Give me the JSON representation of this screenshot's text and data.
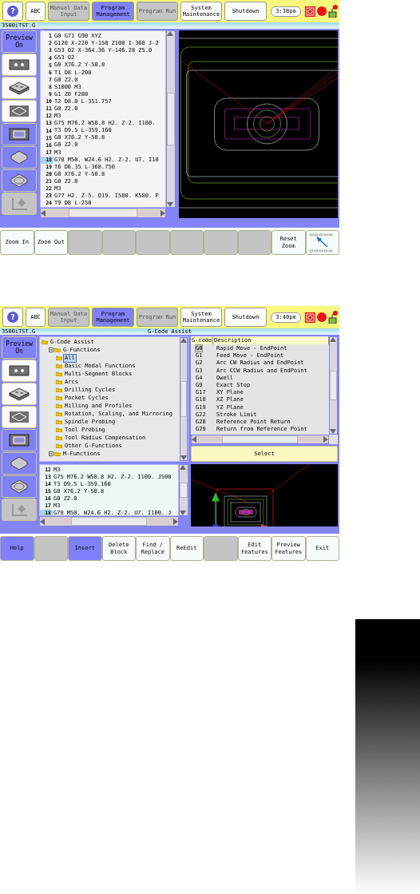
{
  "screens": [
    {
      "kind": "editor",
      "top_bar": {
        "buttons": [
          {
            "kind": "icon",
            "label": "?",
            "selected": false,
            "disabled": false
          },
          {
            "kind": "text",
            "label": "ABC",
            "selected": false,
            "disabled": false
          },
          {
            "kind": "text",
            "label": "Manual Data Input",
            "selected": false,
            "disabled": true
          },
          {
            "kind": "text",
            "label": "Program Management",
            "selected": true,
            "disabled": false
          },
          {
            "kind": "text",
            "label": "Program Run",
            "selected": false,
            "disabled": true
          },
          {
            "kind": "text",
            "label": "System Maintenance",
            "selected": false,
            "disabled": false
          },
          {
            "kind": "text",
            "label": "Shutdown",
            "selected": false,
            "disabled": false
          }
        ],
        "clock": "3:38pm"
      },
      "title_bar": {
        "file": "3500iTST.G"
      },
      "sidebar": [
        {
          "kind": "preview",
          "label": "Preview On",
          "selected": true,
          "disabled": false
        },
        {
          "kind": "plate",
          "selected": false,
          "disabled": false
        },
        {
          "kind": "block",
          "selected": false,
          "disabled": false
        },
        {
          "kind": "outline",
          "selected": false,
          "disabled": false
        },
        {
          "kind": "layout",
          "selected": true,
          "disabled": false
        },
        {
          "kind": "diamond",
          "selected": true,
          "disabled": false
        },
        {
          "kind": "diamond-outline",
          "selected": true,
          "disabled": false
        },
        {
          "kind": "pencil",
          "selected": false,
          "disabled": true
        }
      ],
      "code": {
        "lines": [
          {
            "n": "1",
            "text": "G0 G71 G90 XYZ",
            "selected": false
          },
          {
            "n": "2",
            "text": "G120 X-220 Y-150 Z100 I-360 J-2",
            "selected": false
          },
          {
            "n": "3",
            "text": "G53 O2 X-364.36 Y-146.28 Z5.0",
            "selected": false
          },
          {
            "n": "4",
            "text": "G53 O2",
            "selected": false
          },
          {
            "n": "5",
            "text": "G0 X76.2 Y-50.8",
            "selected": false
          },
          {
            "n": "6",
            "text": "T1 D8 L-200",
            "selected": false
          },
          {
            "n": "7",
            "text": "G0 Z2.0",
            "selected": false
          },
          {
            "n": "8",
            "text": "S1000 M3",
            "selected": false
          },
          {
            "n": "9",
            "text": "G1 Z0 F200",
            "selected": false
          },
          {
            "n": "10",
            "text": "T2 D8.0 L-351.757",
            "selected": false
          },
          {
            "n": "11",
            "text": "G0 Z2.0",
            "selected": false
          },
          {
            "n": "12",
            "text": "M3",
            "selected": false
          },
          {
            "n": "13",
            "text": "G75 M76.2 W50.8 H2. Z-2. I100.",
            "selected": false
          },
          {
            "n": "14",
            "text": "T3 D9.5 L-359.160",
            "selected": false
          },
          {
            "n": "15",
            "text": "G0 X76.2 Y-50.8",
            "selected": false
          },
          {
            "n": "16",
            "text": "G0 Z2.0",
            "selected": false
          },
          {
            "n": "17",
            "text": "M3",
            "selected": false
          },
          {
            "n": "18",
            "text": "G78 M50. W24.6 H2. Z-2. U7. I10",
            "selected": true
          },
          {
            "n": "19",
            "text": "T6 D6.35 L-368.750",
            "selected": false
          },
          {
            "n": "20",
            "text": "G0 X76.2 Y-50.8",
            "selected": false
          },
          {
            "n": "21",
            "text": "G0 Z2.0",
            "selected": false
          },
          {
            "n": "22",
            "text": "M3",
            "selected": false
          },
          {
            "n": "23",
            "text": "G77 H2. Z-5. D19. I580. K580. P",
            "selected": false
          },
          {
            "n": "24",
            "text": "T9 D8 L-250",
            "selected": false
          }
        ]
      },
      "softkeys": [
        {
          "kind": "normal",
          "label": "Zoom In"
        },
        {
          "kind": "normal",
          "label": "Zoom Out"
        },
        {
          "kind": "blank"
        },
        {
          "kind": "blank"
        },
        {
          "kind": "blank"
        },
        {
          "kind": "blank"
        },
        {
          "kind": "blank"
        },
        {
          "kind": "blank"
        },
        {
          "kind": "normal",
          "label": "Reset Zoom"
        },
        {
          "kind": "icon"
        }
      ]
    },
    {
      "kind": "assist",
      "top_bar": {
        "buttons": [
          {
            "kind": "icon",
            "label": "?",
            "selected": false,
            "disabled": false
          },
          {
            "kind": "text",
            "label": "ABC",
            "selected": false,
            "disabled": false
          },
          {
            "kind": "text",
            "label": "Manual Data Input",
            "selected": false,
            "disabled": true
          },
          {
            "kind": "text",
            "label": "Program Management",
            "selected": true,
            "disabled": false
          },
          {
            "kind": "text",
            "label": "Program Run",
            "selected": false,
            "disabled": true
          },
          {
            "kind": "text",
            "label": "System Maintenance",
            "selected": false,
            "disabled": false
          },
          {
            "kind": "text",
            "label": "Shutdown",
            "selected": false,
            "disabled": false
          }
        ],
        "clock": "3:40pm"
      },
      "title_bar": {
        "file": "3500iTST.G",
        "title": "G-Code Assist"
      },
      "sidebar": [
        {
          "kind": "preview",
          "label": "Preview On",
          "selected": true,
          "disabled": false
        },
        {
          "kind": "plate",
          "selected": false,
          "disabled": false
        },
        {
          "kind": "block",
          "selected": false,
          "disabled": false
        },
        {
          "kind": "outline",
          "selected": false,
          "disabled": false
        },
        {
          "kind": "layout",
          "selected": true,
          "disabled": false
        },
        {
          "kind": "diamond",
          "selected": true,
          "disabled": false
        },
        {
          "kind": "diamond-outline",
          "selected": true,
          "disabled": false
        },
        {
          "kind": "pencil",
          "selected": false,
          "disabled": true
        }
      ],
      "tree": [
        {
          "label": "G-Code Assist",
          "selected": false,
          "children": [
            {
              "label": "G-Functions",
              "expanded": true,
              "selected": false,
              "children": [
                {
                  "label": "All",
                  "selected": true
                },
                {
                  "label": "Basic Modal Functions",
                  "selected": false
                },
                {
                  "label": "Multi-Segment Blocks",
                  "selected": false
                },
                {
                  "label": "Arcs",
                  "selected": false
                },
                {
                  "label": "Drilling Cycles",
                  "selected": false
                },
                {
                  "label": "Pocket Cycles",
                  "selected": false
                },
                {
                  "label": "Milling and Profiles",
                  "selected": false
                },
                {
                  "label": "Rotation, Scaling, and Mirroring",
                  "selected": false
                },
                {
                  "label": "Spindle Probing",
                  "selected": false
                },
                {
                  "label": "Tool Probing",
                  "selected": false
                },
                {
                  "label": "Tool Radius Compensation",
                  "selected": false
                },
                {
                  "label": "Other G-Functions",
                  "selected": false
                }
              ]
            },
            {
              "label": "M-Functions",
              "expanded": true,
              "selected": false
            }
          ]
        }
      ],
      "gcode_table": {
        "columns": [
          "G-code",
          "Description"
        ],
        "rows": [
          {
            "code": "G0",
            "description": "Rapid Move - EndPoint",
            "selected": true
          },
          {
            "code": "G1",
            "description": "Feed Move - EndPoint",
            "selected": false
          },
          {
            "code": "G2",
            "description": "Arc CW Radius and EndPoint",
            "selected": false
          },
          {
            "code": "G3",
            "description": "Arc CCW Radius and EndPoint",
            "selected": false
          },
          {
            "code": "G4",
            "description": "Dwell",
            "selected": false
          },
          {
            "code": "G9",
            "description": "Exact Stop",
            "selected": false
          },
          {
            "code": "G17",
            "description": "XY Plane",
            "selected": false
          },
          {
            "code": "G18",
            "description": "XZ Plane",
            "selected": false
          },
          {
            "code": "G19",
            "description": "YZ Plane",
            "selected": false
          },
          {
            "code": "G22",
            "description": "Stroke Limit",
            "selected": false
          },
          {
            "code": "G28",
            "description": "Reference Point Return",
            "selected": false
          },
          {
            "code": "G29",
            "description": "Return from Reference Point",
            "selected": false
          }
        ]
      },
      "select_button": "Select",
      "code": {
        "lines": [
          {
            "n": "12",
            "text": "M3",
            "selected": false
          },
          {
            "n": "13",
            "text": "G75 M76.2 W50.8 H2. Z-2. I100. J500",
            "selected": false
          },
          {
            "n": "14",
            "text": "T3 D9.5 L-359.160",
            "selected": false
          },
          {
            "n": "15",
            "text": "G0 X76.2 Y-50.8",
            "selected": false
          },
          {
            "n": "16",
            "text": "G0 Z2.0",
            "selected": false
          },
          {
            "n": "17",
            "text": "M3",
            "selected": false
          },
          {
            "n": "18",
            "text": "G78 M50. W24.6 H2. Z-2. U7. I100. J",
            "selected": true
          }
        ]
      },
      "softkeys": [
        {
          "kind": "active",
          "label": "Help"
        },
        {
          "kind": "blank"
        },
        {
          "kind": "active",
          "label": "Insert"
        },
        {
          "kind": "normal",
          "label": "Delete Block"
        },
        {
          "kind": "normal",
          "label": "Find / Replace"
        },
        {
          "kind": "normal",
          "label": "ReEdit"
        },
        {
          "kind": "blank"
        },
        {
          "kind": "normal",
          "label": "Edit Features"
        },
        {
          "kind": "normal",
          "label": "Preview Features"
        },
        {
          "kind": "normal",
          "label": "Exit"
        }
      ]
    }
  ]
}
